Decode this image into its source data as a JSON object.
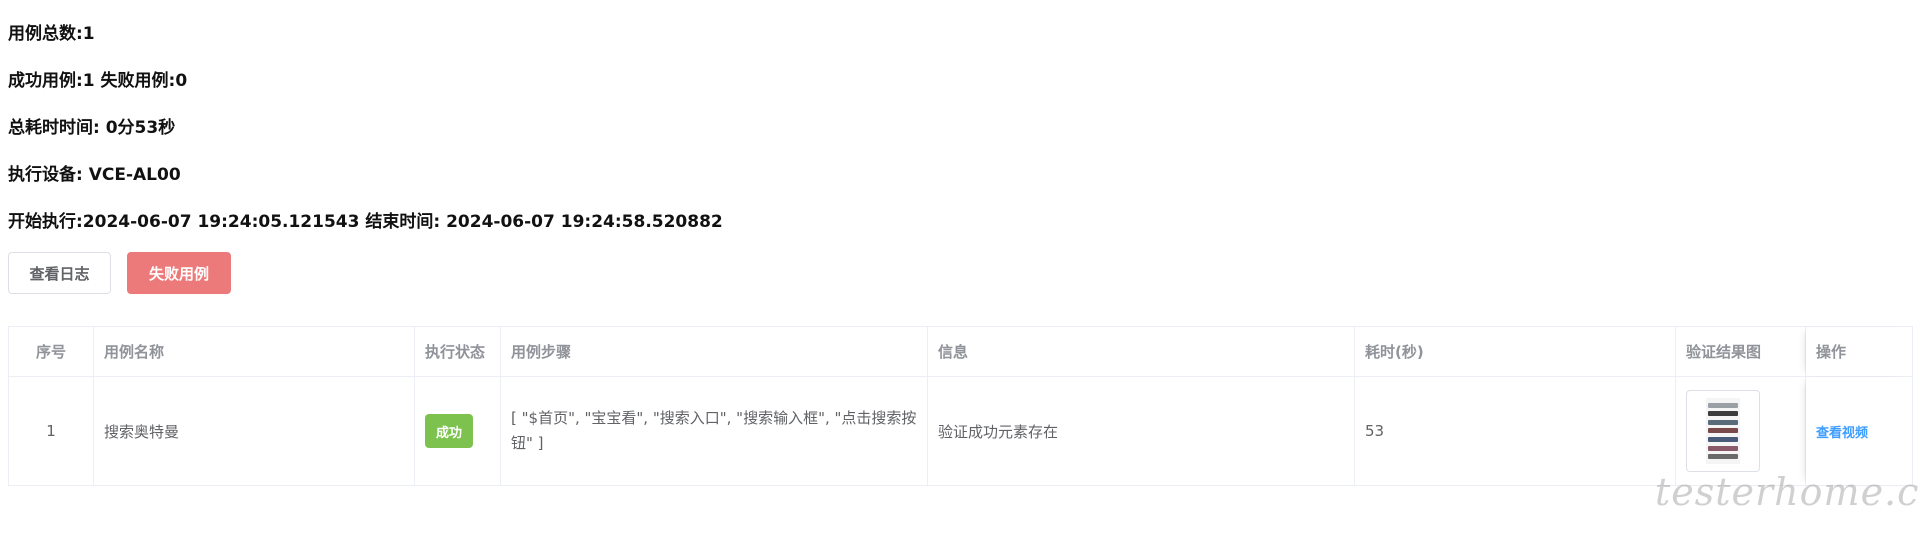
{
  "summary": {
    "total_cases": "用例总数:1",
    "pass_fail": "成功用例:1 失败用例:0",
    "total_time": "总耗时时间: 0分53秒",
    "device": "执行设备: VCE-AL00",
    "time_range": "开始执行:2024-06-07 19:24:05.121543 结束时间: 2024-06-07 19:24:58.520882"
  },
  "buttons": {
    "view_log": "查看日志",
    "failed_cases": "失败用例"
  },
  "table": {
    "headers": {
      "index": "序号",
      "name": "用例名称",
      "status": "执行状态",
      "steps": "用例步骤",
      "info": "信息",
      "duration": "耗时(秒)",
      "screenshot": "验证结果图",
      "action": "操作"
    },
    "rows": [
      {
        "index": "1",
        "name": "搜索奥特曼",
        "status": "成功",
        "steps": "[ \"$首页\", \"宝宝看\", \"搜索入口\", \"搜索输入框\", \"点击搜索按钮\" ]",
        "info": "验证成功元素存在",
        "duration": "53",
        "action": "查看视频"
      }
    ]
  },
  "colors": {
    "fail_button": "#ec7a7a",
    "success_tag": "#7dc24e",
    "link": "#409eff"
  },
  "watermark": "testerhome.com"
}
